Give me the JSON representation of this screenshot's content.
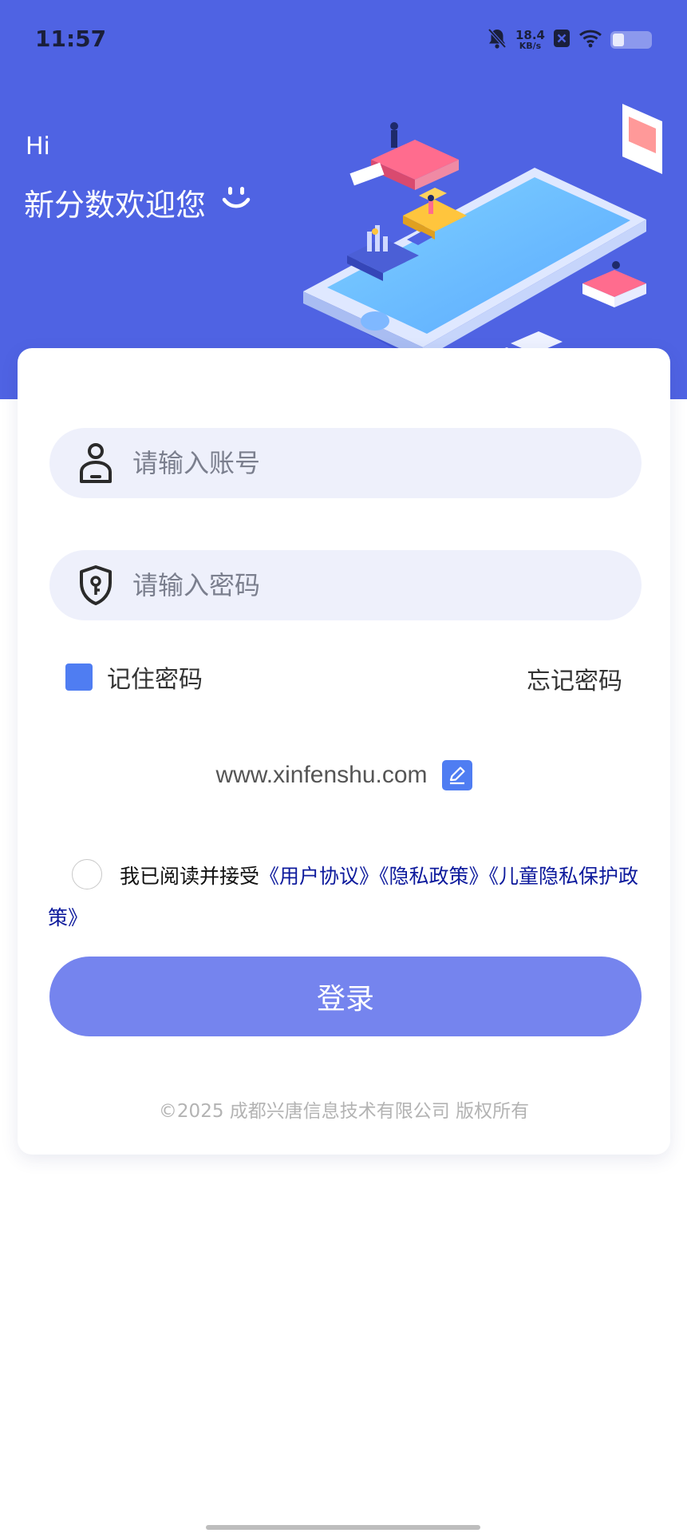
{
  "status_bar": {
    "time": "11:57",
    "net_speed": "18.4",
    "net_unit": "KB/s"
  },
  "greeting": {
    "hi": "Hi",
    "welcome": "新分数欢迎您"
  },
  "form": {
    "account_placeholder": "请输入账号",
    "password_placeholder": "请输入密码",
    "remember_label": "记住密码",
    "forgot_label": "忘记密码"
  },
  "site": {
    "url": "www.xinfenshu.com"
  },
  "agreement": {
    "prefix": "我已阅读并接受",
    "user_agreement": "《用户协议》",
    "privacy_policy": "《隐私政策》",
    "child_privacy": "《儿童隐私保护政策》"
  },
  "login_button": "登录",
  "copyright": "©2025 成都兴唐信息技术有限公司 版权所有",
  "colors": {
    "hero_bg": "#4f63e3",
    "accent": "#4f7df2",
    "button": "#7584ee",
    "link": "#0d1a9c"
  },
  "icons": [
    "bell-off-icon",
    "close-badge-icon",
    "wifi-icon",
    "battery-icon",
    "smile-icon",
    "user-icon",
    "shield-key-icon",
    "edit-icon"
  ]
}
